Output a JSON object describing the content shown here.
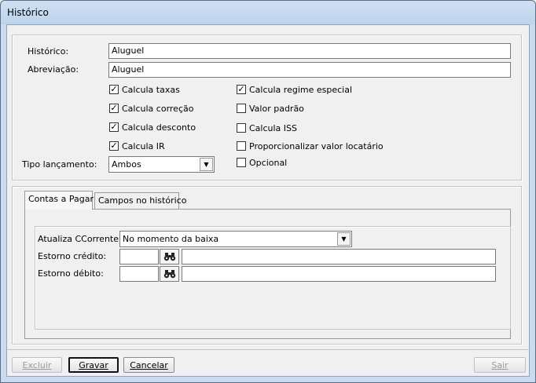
{
  "window": {
    "title": "Histórico"
  },
  "form": {
    "historico_label": "Histórico:",
    "historico_value": "Aluguel",
    "abreviacao_label": "Abreviação:",
    "abreviacao_value": "Aluguel",
    "tipo_label": "Tipo lançamento:",
    "tipo_value": "Ambos"
  },
  "checkboxes": {
    "left": [
      {
        "label": "Calcula taxas",
        "checked": true
      },
      {
        "label": "Calcula correção",
        "checked": true
      },
      {
        "label": "Calcula desconto",
        "checked": true
      },
      {
        "label": "Calcula IR",
        "checked": true
      }
    ],
    "right": [
      {
        "label": "Calcula regime especial",
        "checked": true
      },
      {
        "label": "Valor padrão",
        "checked": false
      },
      {
        "label": "Calcula ISS",
        "checked": false
      },
      {
        "label": "Proporcionalizar valor locatário",
        "checked": false
      },
      {
        "label": "Opcional",
        "checked": false
      }
    ]
  },
  "tabs": [
    {
      "label": "Contas a Pagar",
      "active": true
    },
    {
      "label": "Campos no histórico",
      "active": false
    }
  ],
  "contas": {
    "atualiza_label": "Atualiza CCorrente:",
    "atualiza_value": "No momento da baixa",
    "estorno_credito_label": "Estorno crédito:",
    "estorno_debito_label": "Estorno débito:"
  },
  "buttons": {
    "excluir": "Excluir",
    "gravar": "Gravar",
    "cancelar": "Cancelar",
    "sair": "Sair"
  },
  "check_glyph": "✓"
}
